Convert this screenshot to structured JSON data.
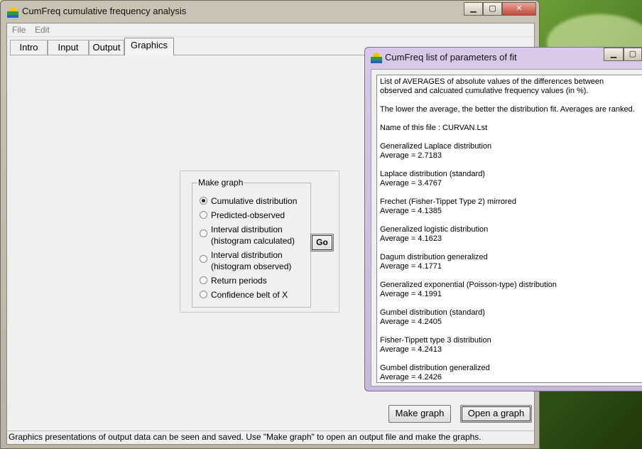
{
  "main_window": {
    "title": "CumFreq cumulative frequency analysis",
    "caption_buttons": {
      "minimize": "▁",
      "maximize": "▢",
      "close": "✕"
    }
  },
  "menu": [
    "File",
    "Edit"
  ],
  "tabs": [
    {
      "label": "Intro",
      "active": false
    },
    {
      "label": "Input",
      "active": false
    },
    {
      "label": "Output",
      "active": false
    },
    {
      "label": "Graphics",
      "active": true
    }
  ],
  "make_graph": {
    "legend": "Make graph",
    "options": [
      {
        "label": "Cumulative distribution",
        "checked": true
      },
      {
        "label": "Predicted-observed",
        "checked": false
      },
      {
        "label": "Interval distribution\n(histogram calculated)",
        "checked": false
      },
      {
        "label": "Interval distribution\n(histogram observed)",
        "checked": false
      },
      {
        "label": "Return periods",
        "checked": false
      },
      {
        "label": "Confidence belt of X",
        "checked": false
      }
    ],
    "go_label": "Go"
  },
  "bottom_buttons": {
    "make_graph": "Make graph",
    "open_graph": "Open a graph"
  },
  "status_text": "Graphics presentations of output data can be seen and saved. Use \"Make graph\" to open an output file and make the graphs.",
  "fit_window": {
    "title": "CumFreq list of parameters of fit",
    "caption_buttons": {
      "minimize": "▁",
      "maximize": "▢"
    },
    "lines": [
      "List of AVERAGES of absolute values of the differences between",
      "observed and calcuated cumulative frequency values (in %).",
      "",
      "The lower the average, the better the distribution fit. Averages are ranked.",
      "",
      "Name of this file : CURVAN.Lst",
      "",
      "Generalized Laplace distribution",
      "Average = 2.7183",
      "",
      "Laplace distribution (standard)",
      "Average = 3.4767",
      "",
      "Frechet (Fisher-Tippet Type 2) mirrored",
      "Average = 4.1385",
      "",
      "Generalized logistic distribution",
      "Average = 4.1623",
      "",
      "Dagum distribution generalized",
      "Average = 4.1771",
      "",
      "Generalized exponential (Poisson-type) distribution",
      "Average = 4.1991",
      "",
      "Gumbel distribution (standard)",
      "Average = 4.2405",
      "",
      "Fisher-Tippett type 3 distribution",
      "Average = 4.2413",
      "",
      "Gumbel distribution generalized",
      "Average = 4.2426"
    ]
  },
  "colors": {
    "main_frame": "#c9c3b3",
    "fit_frame": "#d8c9ea",
    "close_button": "#c0473a"
  }
}
